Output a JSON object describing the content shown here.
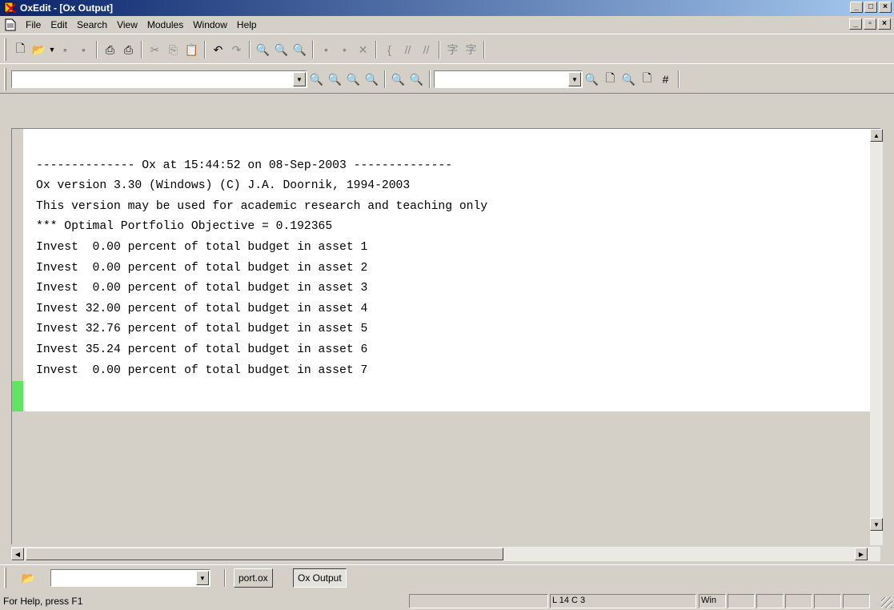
{
  "window": {
    "title": "OxEdit - [Ox Output]",
    "controls": {
      "minimize": "_",
      "maximize": "□",
      "close": "×"
    },
    "mdi_controls": {
      "minimize": "_",
      "restore": "▫",
      "close": "×"
    }
  },
  "menu": [
    "File",
    "Edit",
    "Search",
    "View",
    "Modules",
    "Window",
    "Help"
  ],
  "toolbar1": {
    "icons": [
      "new-file-icon",
      "open-folder-icon",
      "save-icon",
      "save-all-icon",
      "print-icon",
      "print-preview-icon",
      "cut-icon",
      "copy-icon",
      "paste-icon",
      "undo-icon",
      "redo-icon",
      "find-icon",
      "find-in-files-icon",
      "find-clip-icon",
      "toggle-bookmark-icon",
      "next-bookmark-icon",
      "clear-bookmarks-icon",
      "brace-icon",
      "comment-icon",
      "uncomment-icon",
      "spell-icon",
      "spell-all-icon"
    ]
  },
  "toolbar2": {
    "search_value": "",
    "module_value": "",
    "icons": [
      "find-next-icon",
      "find-prev-icon",
      "find-case-icon",
      "find-word-icon",
      "replace-icon",
      "replace-all-icon",
      "run-icon",
      "new-doc-icon",
      "run-module-icon",
      "run-file-icon",
      "run-number-icon"
    ]
  },
  "output": {
    "lines": [
      "-------------- Ox at 15:44:52 on 08-Sep-2003 --------------",
      "",
      "Ox version 3.30 (Windows) (C) J.A. Doornik, 1994-2003",
      "This version may be used for academic research and teaching only",
      "*** Optimal Portfolio Objective = 0.192365",
      "Invest  0.00 percent of total budget in asset 1",
      "Invest  0.00 percent of total budget in asset 2",
      "Invest  0.00 percent of total budget in asset 3",
      "Invest 32.00 percent of total budget in asset 4",
      "Invest 32.76 percent of total budget in asset 5",
      "Invest 35.24 percent of total budget in asset 6",
      "Invest  0.00 percent of total budget in asset 7"
    ]
  },
  "filebar": {
    "combo_value": "",
    "tabs": [
      {
        "label": "port.ox",
        "active": false
      },
      {
        "label": "Ox Output",
        "active": true
      }
    ]
  },
  "status": {
    "help": "For Help, press F1",
    "position": "L 14 C 3",
    "mode": "Win"
  }
}
